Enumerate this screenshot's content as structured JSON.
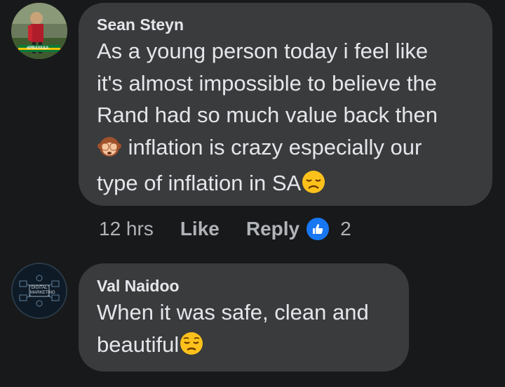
{
  "comments": [
    {
      "author": "Sean Steyn",
      "lines": [
        "As a young person today i feel like",
        "it's almost impossible to believe the",
        "Rand had so much value back then",
        "inflation is crazy especially our",
        "type of inflation in SA"
      ],
      "emojis": [
        "see-no-evil-monkey-icon",
        "disappointed-face-icon"
      ],
      "avatar_caption": "#PRAYASA",
      "meta": {
        "time": "12 hrs",
        "like_label": "Like",
        "reply_label": "Reply",
        "reaction_count": "2"
      }
    },
    {
      "author": "Val Naidoo",
      "lines": [
        "When it was safe, clean and",
        "beautiful"
      ],
      "emojis": [
        "pensive-face-icon"
      ],
      "avatar_caption": "DIGITAL MARKETING"
    }
  ],
  "colors": {
    "background": "#18191a",
    "bubble": "#3a3b3c",
    "text": "#e4e6eb",
    "secondary_text": "#b0b3b8",
    "like_blue": "#1877f2"
  }
}
